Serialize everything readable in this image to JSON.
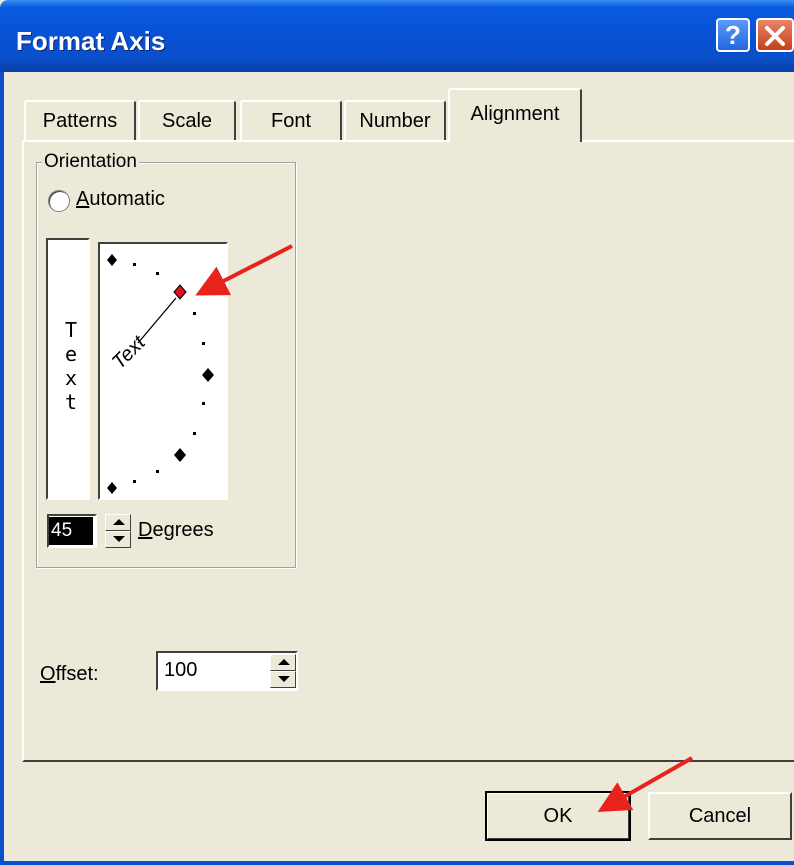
{
  "window": {
    "title": "Format Axis",
    "help_glyph": "?",
    "colors": {
      "titlebar": "#0852D6",
      "face": "#ECE9D8",
      "annotation_arrow": "#E8231C"
    }
  },
  "tabs": [
    {
      "label": "Patterns",
      "active": false
    },
    {
      "label": "Scale",
      "active": false
    },
    {
      "label": "Font",
      "active": false
    },
    {
      "label": "Number",
      "active": false
    },
    {
      "label": "Alignment",
      "active": true
    }
  ],
  "orientation": {
    "group_label": "Orientation",
    "automatic_label_access": "A",
    "automatic_label_rest": "utomatic",
    "automatic_checked": false,
    "vertical_text_chars": [
      "T",
      "e",
      "x",
      "t"
    ],
    "dial_text": "Text",
    "degrees_value": "45",
    "degrees_label_access": "D",
    "degrees_label_rest": "egrees"
  },
  "offset": {
    "label_access": "O",
    "label_rest": "ffset:",
    "value": "100"
  },
  "buttons": {
    "ok": "OK",
    "cancel": "Cancel"
  },
  "icons": [
    "help-icon",
    "close-icon",
    "spin-up-icon",
    "spin-down-icon",
    "annotation-arrow-icon"
  ]
}
